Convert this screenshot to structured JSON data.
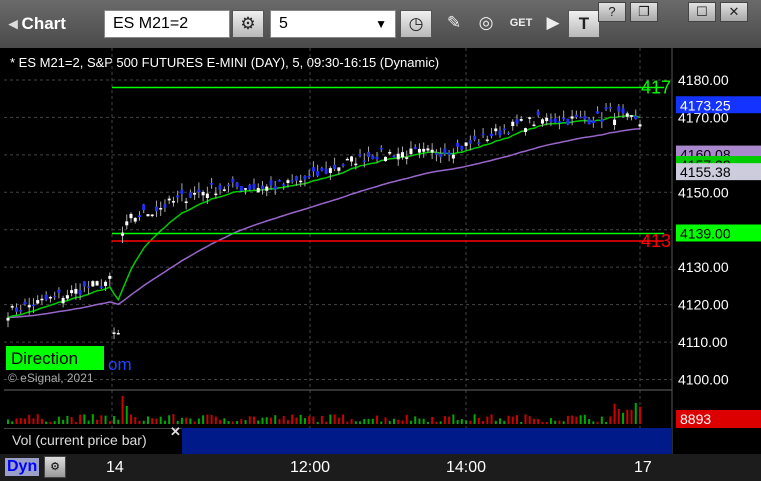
{
  "window": {
    "title": "Chart",
    "symbol": "ES M21=2",
    "interval": "5",
    "buttons": [
      "?",
      "❐",
      "☐",
      "✕"
    ]
  },
  "toolbar_icons": [
    "settings-icon",
    "clock-icon",
    "pencil-icon",
    "chart-icon",
    "get-icon",
    "play-icon",
    "text-icon"
  ],
  "chart_header": "* ES M21=2, S&P 500 FUTURES E-MINI (DAY), 5, 09:30-16:15 (Dynamic)",
  "watermark": "© eSignal, 2021",
  "direction_text": "Direction",
  "om_text": "om",
  "colors": {
    "up_candle": "#ffffff",
    "down_candle": "#1f2fff",
    "ema_fast": "#00cc00",
    "ma_slow": "#9966cc",
    "level_green": "#00ff00",
    "level_red": "#ff0000"
  },
  "chart_data": {
    "type": "candlestick",
    "title": "* ES M21=2, S&P 500 FUTURES E-MINI (DAY), 5, 09:30-16:15 (Dynamic)",
    "ylim": [
      4098,
      4184
    ],
    "y_ticks": [
      "4180.00",
      "4170.00",
      "4160.00",
      "4150.00",
      "4140.00",
      "4130.00",
      "4120.00",
      "4110.00",
      "4100.00"
    ],
    "x_ticks": [
      "14",
      "12:00",
      "14:00",
      "17"
    ],
    "price_badges": [
      {
        "label": "4173.25",
        "value": 4173.25,
        "bg": "#1433ff",
        "fg": "#ffffff"
      },
      {
        "label": "4160.08",
        "value": 4160.08,
        "bg": "#aa88cc",
        "fg": "#000000"
      },
      {
        "label": "4157.28",
        "value": 4157.28,
        "bg": "#00cc00",
        "fg": "#000000"
      },
      {
        "label": "4155.38",
        "value": 4155.38,
        "bg": "#ccccdd",
        "fg": "#000000"
      },
      {
        "label": "4139.00",
        "value": 4139.0,
        "bg": "#00ff00",
        "fg": "#000000"
      }
    ],
    "levels": [
      {
        "value": 4178,
        "color": "#00ff00",
        "label": "417"
      },
      {
        "value": 4139,
        "color": "#00ff00",
        "label": ""
      },
      {
        "value": 4137,
        "color": "#ff0000",
        "label": "413"
      }
    ],
    "volume_badge": "8893",
    "volume_label": "Vol (current price bar)"
  }
}
